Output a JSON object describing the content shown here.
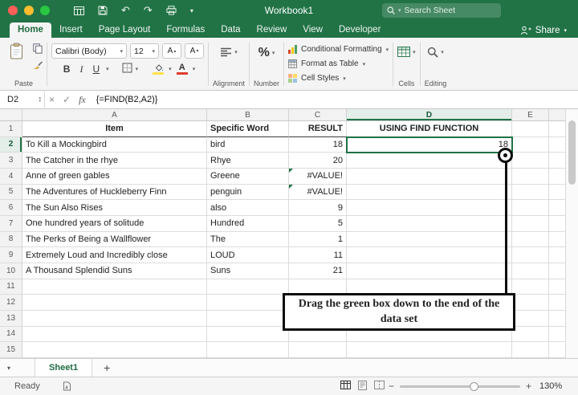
{
  "titlebar": {
    "title": "Workbook1",
    "search_placeholder": "Search Sheet"
  },
  "tabbar": {
    "tabs": [
      "Home",
      "Insert",
      "Page Layout",
      "Formulas",
      "Data",
      "Review",
      "View",
      "Developer"
    ],
    "share_label": "Share"
  },
  "ribbon": {
    "paste_label": "Paste",
    "font_name": "Calibri (Body)",
    "font_size": "12",
    "bold": "B",
    "italic": "I",
    "underline": "U",
    "font_letter": "A",
    "alignment_label": "Alignment",
    "number_label": "Number",
    "percent": "%",
    "conditional_formatting": "Conditional Formatting",
    "format_as_table": "Format as Table",
    "cell_styles": "Cell Styles",
    "cells_label": "Cells",
    "editing_label": "Editing"
  },
  "formula_bar": {
    "cell_ref": "D2",
    "fx_label": "fx",
    "formula": "{=FIND(B2,A2)}"
  },
  "sheet": {
    "cols": [
      "A",
      "B",
      "C",
      "D",
      "E"
    ],
    "rows": [
      {
        "n": "1",
        "a": "Item",
        "b": "Specific Word",
        "c": "RESULT",
        "d": "USING FIND FUNCTION",
        "header": true
      },
      {
        "n": "2",
        "a": "To Kill a Mockingbird",
        "b": "bird",
        "c": "18",
        "d": "18",
        "sel": true
      },
      {
        "n": "3",
        "a": "The Catcher in the rhye",
        "b": "Rhye",
        "c": "20"
      },
      {
        "n": "4",
        "a": "Anne of green gables",
        "b": "Greene",
        "c": "#VALUE!",
        "err": true
      },
      {
        "n": "5",
        "a": "The Adventures of Huckleberry Finn",
        "b": "penguin",
        "c": "#VALUE!",
        "err": true
      },
      {
        "n": "6",
        "a": "The Sun Also Rises",
        "b": "also",
        "c": "9"
      },
      {
        "n": "7",
        "a": "One hundred years of solitude",
        "b": "Hundred",
        "c": "5"
      },
      {
        "n": "8",
        "a": "The Perks of Being a Wallflower",
        "b": "The",
        "c": "1"
      },
      {
        "n": "9",
        "a": "Extremely Loud and Incredibly close",
        "b": "LOUD",
        "c": "11"
      },
      {
        "n": "10",
        "a": "A Thousand Splendid Suns",
        "b": "Suns",
        "c": "21"
      },
      {
        "n": "11"
      },
      {
        "n": "12"
      },
      {
        "n": "13"
      },
      {
        "n": "14"
      },
      {
        "n": "15"
      }
    ]
  },
  "callout": {
    "text": "Drag the green box down to the end of the data set"
  },
  "sheet_tabs": {
    "active_tab": "Sheet1",
    "add_label": "+"
  },
  "status": {
    "ready": "Ready",
    "zoom": "130%"
  },
  "icons": {
    "caret": "▾",
    "undo": "↶",
    "redo": "↷",
    "close": "×",
    "check": "✓",
    "minus": "−",
    "plus": "+",
    "up_triangle": "▴",
    "down_triangle": "▾"
  },
  "colors": {
    "excel_green": "#217346",
    "selection_green": "#1E7145",
    "error_indicator_green": "#217346",
    "fill_yellow": "#FFE14D",
    "font_color_red": "#E03C31"
  }
}
